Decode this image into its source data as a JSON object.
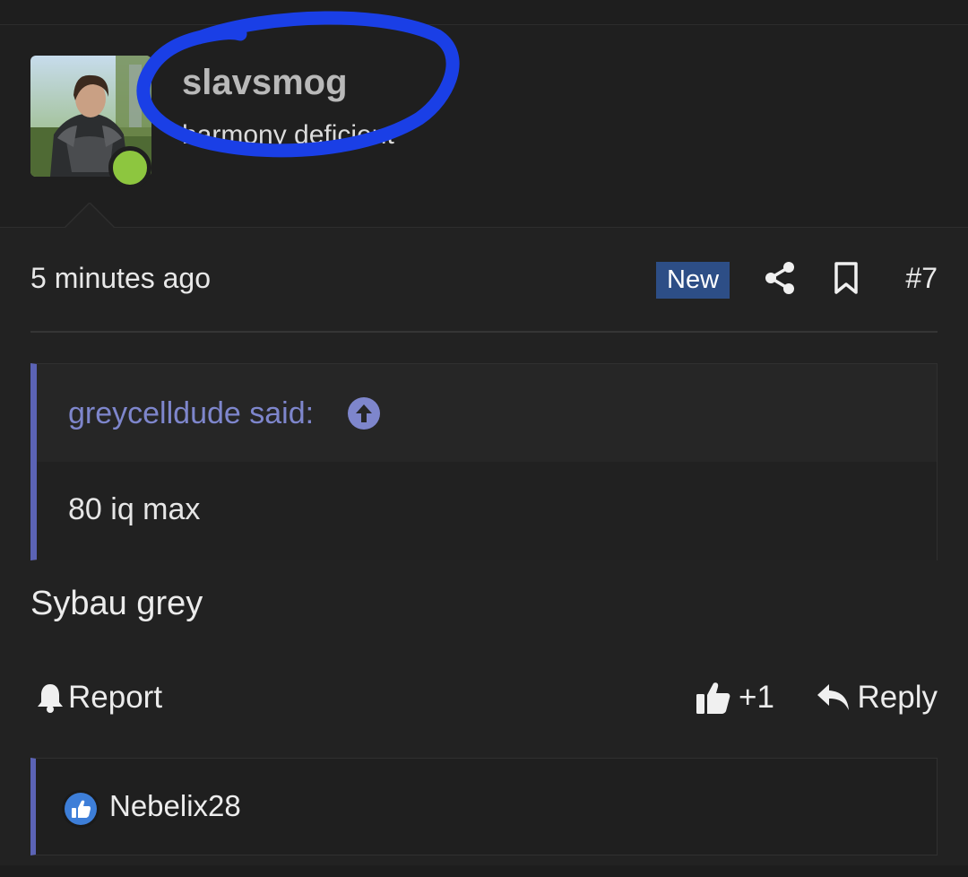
{
  "post": {
    "username": "slavsmog",
    "user_title": "harmony deficient",
    "online": true,
    "timestamp": "5 minutes ago",
    "badge": "New",
    "post_number": "#7",
    "body": "Sybau grey"
  },
  "quote": {
    "author_label": "greycelldude said:",
    "text": "80 iq max"
  },
  "actions": {
    "report_label": "Report",
    "like_count": "+1",
    "reply_label": "Reply"
  },
  "reactions": {
    "users": [
      "Nebelix28"
    ]
  },
  "icons": {
    "share": "share-icon",
    "bookmark": "bookmark-icon",
    "quote_jump": "arrow-up-circle-icon",
    "report": "bell-icon",
    "like": "thumbs-up-icon",
    "reply": "reply-arrow-icon",
    "reaction": "like-reaction-icon"
  },
  "colors": {
    "background": "#222222",
    "header_background": "#1f1f1f",
    "accent": "#5b63b5",
    "quote_author": "#7e86cc",
    "badge": "#2d4e86",
    "online": "#8dc63f",
    "scribble": "#1a3fe6",
    "reaction": "#3d7ed8"
  }
}
